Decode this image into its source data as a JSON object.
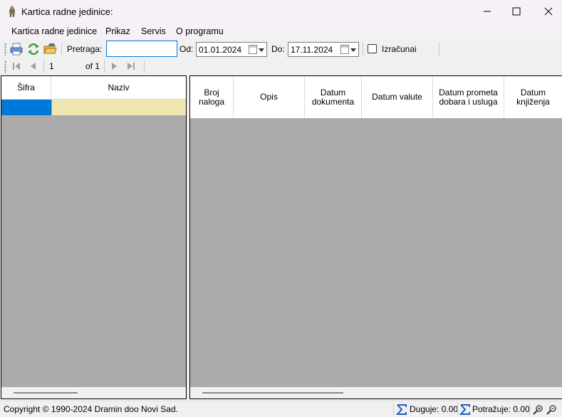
{
  "window": {
    "title": "Kartica radne jedinice:",
    "minimize_glyph": "—",
    "maximize_glyph": "☐",
    "close_glyph": "✕"
  },
  "menu": {
    "items": [
      "Kartica radne jedinice",
      "Prikaz",
      "Servis",
      "O programu"
    ]
  },
  "toolbar": {
    "search_label": "Pretraga:",
    "search_value": "",
    "from_label": "Od:",
    "from_date": "01.01.2024",
    "to_label": "Do:",
    "to_date": "17.11.2024",
    "calc_label": "Izračunai",
    "calc_checked": false,
    "icons": [
      "print-icon",
      "refresh-icon",
      "open-folder-icon"
    ]
  },
  "navigator": {
    "page_value": "1",
    "of_label": "of 1"
  },
  "left_grid": {
    "columns": [
      "Šifra",
      "Naziv"
    ],
    "rows": [
      {
        "sifra": "",
        "naziv": ""
      }
    ]
  },
  "right_grid": {
    "columns": [
      "Broj naloga",
      "Opis",
      "Datum dokumenta",
      "Datum valute",
      "Datum prometa dobara i usluga",
      "Datum knjiženja"
    ]
  },
  "status": {
    "copyright": "Copyright © 1990-2024 Dramin doo Novi Sad.",
    "duguje": "Duguje: 0.00",
    "potrazuje": "Potražuje: 0.00"
  },
  "colors": {
    "grid_background": "#ababab",
    "selected_cell": "#0078d7",
    "current_row": "#eee8b0",
    "focus_border": "#0078d7",
    "sigma": "#1f5fbf"
  }
}
